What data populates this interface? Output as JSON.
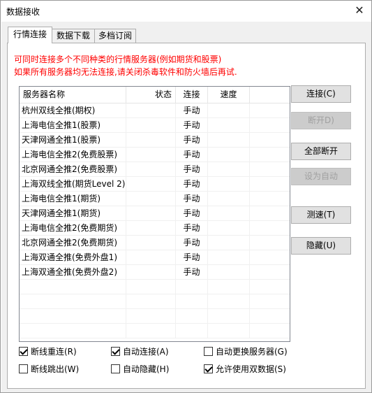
{
  "window": {
    "title": "数据接收",
    "close_glyph": "✕"
  },
  "tabs": [
    {
      "label": "行情连接",
      "active": true
    },
    {
      "label": "数据下载",
      "active": false
    },
    {
      "label": "多档订阅",
      "active": false
    }
  ],
  "notice": {
    "line1": "可同时连接多个不同种类的行情服务器(例如期货和股票)",
    "line2": "如果所有服务器均无法连接,请关闭杀毒软件和防火墙后再试.",
    "color": "#ff0000"
  },
  "list": {
    "headers": {
      "name": "服务器名称",
      "status": "状态",
      "connect": "连接",
      "speed": "速度"
    },
    "rows": [
      {
        "name": "杭州双线全推(期权)",
        "status": "",
        "connect": "手动",
        "speed": ""
      },
      {
        "name": "上海电信全推1(股票)",
        "status": "",
        "connect": "手动",
        "speed": ""
      },
      {
        "name": "天津网通全推1(股票)",
        "status": "",
        "connect": "手动",
        "speed": ""
      },
      {
        "name": "上海电信全推2(免费股票)",
        "status": "",
        "connect": "手动",
        "speed": ""
      },
      {
        "name": "北京网通全推2(免费股票)",
        "status": "",
        "connect": "手动",
        "speed": ""
      },
      {
        "name": "上海双线全推(期货Level 2)",
        "status": "",
        "connect": "手动",
        "speed": ""
      },
      {
        "name": "上海电信全推1(期货)",
        "status": "",
        "connect": "手动",
        "speed": ""
      },
      {
        "name": "天津网通全推1(期货)",
        "status": "",
        "connect": "手动",
        "speed": ""
      },
      {
        "name": "上海电信全推2(免费期货)",
        "status": "",
        "connect": "手动",
        "speed": ""
      },
      {
        "name": "北京网通全推2(免费期货)",
        "status": "",
        "connect": "手动",
        "speed": ""
      },
      {
        "name": "上海双通全推(免费外盘1)",
        "status": "",
        "connect": "手动",
        "speed": ""
      },
      {
        "name": "上海双通全推(免费外盘2)",
        "status": "",
        "connect": "手动",
        "speed": ""
      }
    ]
  },
  "buttons": {
    "connect": "连接(C)",
    "disconnect": "断开D)",
    "disconnect_all": "全部断开",
    "set_auto": "设为自动",
    "speed_test": "测速(T)",
    "hide": "隐藏(U)"
  },
  "options": {
    "reconnect": {
      "label": "断线重连(R)",
      "checked": true
    },
    "auto_connect": {
      "label": "自动连接(A)",
      "checked": true
    },
    "auto_switch": {
      "label": "自动更换服务器(G)",
      "checked": false
    },
    "jump_out": {
      "label": "断线跳出(W)",
      "checked": false
    },
    "auto_hide": {
      "label": "自动隐藏(H)",
      "checked": false
    },
    "dual_data": {
      "label": "允许使用双数据(S)",
      "checked": true
    }
  }
}
